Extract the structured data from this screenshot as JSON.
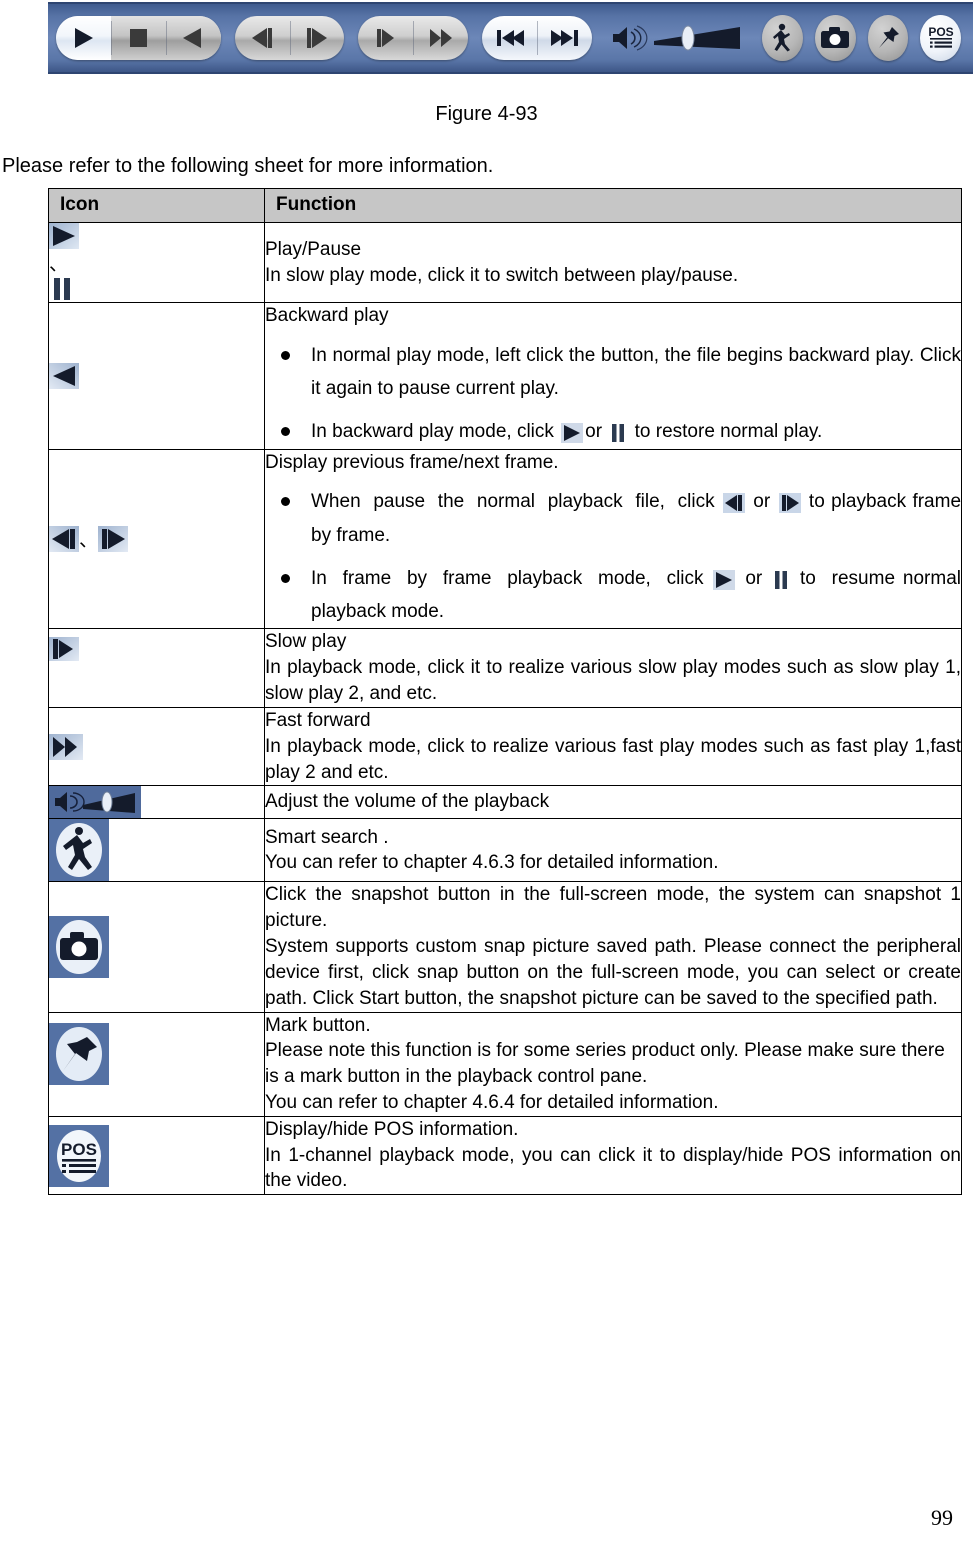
{
  "figure": {
    "caption": "Figure 4-93",
    "toolbar_buttons": [
      {
        "name": "play-button",
        "icon": "play-icon"
      },
      {
        "name": "stop-button",
        "icon": "stop-icon"
      },
      {
        "name": "backward-play-button",
        "icon": "backward-play-icon"
      },
      {
        "name": "previous-frame-button",
        "icon": "previous-frame-icon"
      },
      {
        "name": "next-frame-button",
        "icon": "next-frame-icon"
      },
      {
        "name": "slow-play-button",
        "icon": "slow-play-icon"
      },
      {
        "name": "fast-forward-button",
        "icon": "fast-forward-icon"
      },
      {
        "name": "previous-file-button",
        "icon": "skip-backward-icon"
      },
      {
        "name": "next-file-button",
        "icon": "skip-forward-icon"
      },
      {
        "name": "volume-control",
        "icon": "speaker-icon"
      },
      {
        "name": "smart-search-button",
        "icon": "walking-person-icon"
      },
      {
        "name": "snapshot-button",
        "icon": "camera-icon"
      },
      {
        "name": "mark-button",
        "icon": "pushpin-icon"
      },
      {
        "name": "pos-button",
        "icon": "pos-icon"
      }
    ]
  },
  "lead_text": "Please refer to the following sheet for more information.",
  "table": {
    "headers": [
      "Icon",
      "Function"
    ],
    "rows": [
      {
        "icons": [
          "play-icon",
          "pause-icon"
        ],
        "separator": "、",
        "title": "Play/Pause",
        "lines": [
          "In slow play mode, click it to switch between play/pause."
        ],
        "bullets": []
      },
      {
        "icons": [
          "backward-play-icon"
        ],
        "separator": "",
        "title": "Backward play",
        "lines": [],
        "bullets": [
          "In normal play mode, left click the button, the file begins backward play. Click it again to pause current play.",
          "In backward play mode, click  or  to restore normal play."
        ]
      },
      {
        "icons": [
          "previous-frame-icon",
          "next-frame-icon"
        ],
        "separator": "、",
        "title": "Display previous frame/next frame.",
        "lines": [],
        "bullets": [
          "When pause the normal playback file, click  or  to playback frame by frame.",
          "In frame by frame playback mode, click  or  to resume normal playback mode."
        ]
      },
      {
        "icons": [
          "slow-play-icon"
        ],
        "separator": "",
        "title": "Slow play",
        "lines": [
          "In playback mode, click it to realize various slow play modes such as slow play 1, slow play 2, and etc."
        ],
        "bullets": []
      },
      {
        "icons": [
          "fast-forward-icon"
        ],
        "separator": "",
        "title": "Fast forward",
        "lines": [
          "In playback mode, click to realize various fast play modes such as fast play 1,fast play 2 and etc."
        ],
        "bullets": []
      },
      {
        "icons": [
          "volume-icon"
        ],
        "separator": "",
        "title": "Adjust the volume of the playback",
        "lines": [],
        "bullets": []
      },
      {
        "icons": [
          "walking-person-icon"
        ],
        "separator": "",
        "title": "Smart search .",
        "lines": [
          "You can refer to chapter 4.6.3 for detailed information."
        ],
        "bullets": []
      },
      {
        "icons": [
          "camera-icon"
        ],
        "separator": "",
        "title": "Click the snapshot button in the full-screen mode, the system can snapshot 1 picture.",
        "lines": [
          "System supports custom snap picture saved path. Please connect the peripheral device first, click snap button on the full-screen mode, you can select or create path. Click Start button, the snapshot picture can be saved to the specified path."
        ],
        "bullets": []
      },
      {
        "icons": [
          "pushpin-icon"
        ],
        "separator": "",
        "title": "Mark button.",
        "lines": [
          "Please note this function is for some series product only. Please make sure there is a mark button in the playback control pane.",
          "You can refer to chapter 4.6.4 for detailed information."
        ],
        "bullets": []
      },
      {
        "icons": [
          "pos-icon"
        ],
        "separator": "",
        "title": "Display/hide POS information.",
        "lines": [
          "In 1-channel playback mode, you can click it to display/hide POS information on the video."
        ],
        "bullets": []
      }
    ]
  },
  "page_number": "99",
  "colors": {
    "toolbar_blue": "#5773a6",
    "header_gray": "#c6c6c6",
    "icon_ink": "#141b2b"
  }
}
